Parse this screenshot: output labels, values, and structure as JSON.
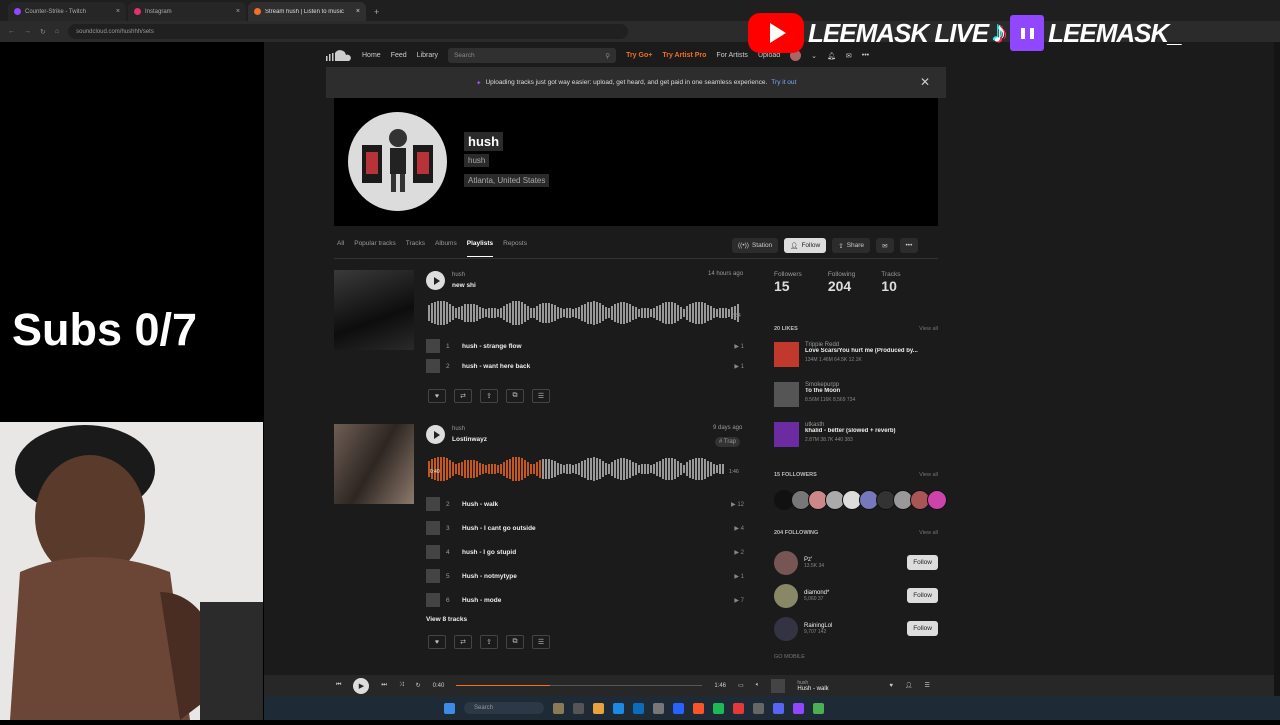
{
  "browser": {
    "tabs": [
      {
        "label": "Counter-Strike - Twitch",
        "color": "#9146ff"
      },
      {
        "label": "Instagram",
        "color": "#e1306c"
      },
      {
        "label": "Stream hush | Listen to music p",
        "color": "#f26f23"
      }
    ],
    "url": "soundcloud.com/hushhh/sets"
  },
  "overlay": {
    "brand_youtube": "LEEMASK LIVE",
    "brand_twitch": "LEEMASK_",
    "subs": "Subs 0/7"
  },
  "header": {
    "nav": [
      "Home",
      "Feed",
      "Library"
    ],
    "search_placeholder": "Search",
    "go_plus": "Try Go+",
    "artist_pro": "Try Artist Pro",
    "for_artists": "For Artists",
    "upload": "Upload"
  },
  "banner": {
    "text": "Uploading tracks just got way easier: upload, get heard, and get paid in one seamless experience.",
    "link": "Try it out"
  },
  "profile": {
    "name": "hush",
    "username": "hush",
    "location": "Atlanta, United States"
  },
  "tabs": [
    "All",
    "Popular tracks",
    "Tracks",
    "Albums",
    "Playlists",
    "Reposts"
  ],
  "actions": {
    "station": "Station",
    "follow": "Follow",
    "share": "Share"
  },
  "playlists": [
    {
      "user": "hush",
      "title": "new shi",
      "time": "14 hours ago",
      "duration": "2:34",
      "tag": "",
      "tracks": [
        {
          "num": "1",
          "name": "hush - strange flow",
          "plays": "1"
        },
        {
          "num": "2",
          "name": "hush - want here back",
          "plays": "1"
        }
      ]
    },
    {
      "user": "hush",
      "title": "Lostinwayz",
      "time": "9 days ago",
      "duration": "1:46",
      "tag": "# Trap",
      "elapsed": "0:40",
      "tracks": [
        {
          "num": "2",
          "name": "Hush - walk",
          "plays": "12"
        },
        {
          "num": "3",
          "name": "Hush - I cant go outside",
          "plays": "4"
        },
        {
          "num": "4",
          "name": "hush - I go stupid",
          "plays": "2"
        },
        {
          "num": "5",
          "name": "Hush - notmytype",
          "plays": "1"
        },
        {
          "num": "6",
          "name": "Hush - mode",
          "plays": "7"
        }
      ],
      "view_all": "View 8 tracks"
    }
  ],
  "stats": [
    {
      "label": "Followers",
      "value": "15"
    },
    {
      "label": "Following",
      "value": "204"
    },
    {
      "label": "Tracks",
      "value": "10"
    }
  ],
  "likes": {
    "heading": "20 LIKES",
    "view_all": "View all",
    "items": [
      {
        "user": "Trippie Redd",
        "title": "Love Scars/You hurt me (Produced by...",
        "stats": "134M  1.46M  64.5K  12.1K",
        "color": "#c0392b"
      },
      {
        "user": "Smokepurpp",
        "title": "To the Moon",
        "stats": "8.56M  116K  8,569  734",
        "color": "#555555"
      },
      {
        "user": "utkasth",
        "title": "khalid - better (slowed + reverb)",
        "stats": "2.87M  38.7K  440  383",
        "color": "#6a2ca0"
      }
    ]
  },
  "followers": {
    "heading": "15 FOLLOWERS",
    "view_all": "View all",
    "colors": [
      "#111111",
      "#777777",
      "#cc8888",
      "#aaaaaa",
      "#dddddd",
      "#7777bb",
      "#333333",
      "#999999",
      "#aa5555",
      "#cc44aa"
    ]
  },
  "following": {
    "heading": "204 FOLLOWING",
    "view_all": "View all",
    "items": [
      {
        "name": "Pz'",
        "stats": "13.5K  34",
        "button": "Follow",
        "color": "#775555"
      },
      {
        "name": "diamond*",
        "stats": "5,060  37",
        "button": "Follow",
        "color": "#888866"
      },
      {
        "name": "RainingLol",
        "stats": "9,707  142",
        "button": "Follow",
        "color": "#333344"
      }
    ]
  },
  "go_mobile": "GO MOBILE",
  "player": {
    "elapsed": "0:40",
    "duration": "1:46",
    "progress_fraction": 0.38,
    "artist": "hush",
    "title": "Hush - walk"
  },
  "taskbar": {
    "search": "Search"
  }
}
